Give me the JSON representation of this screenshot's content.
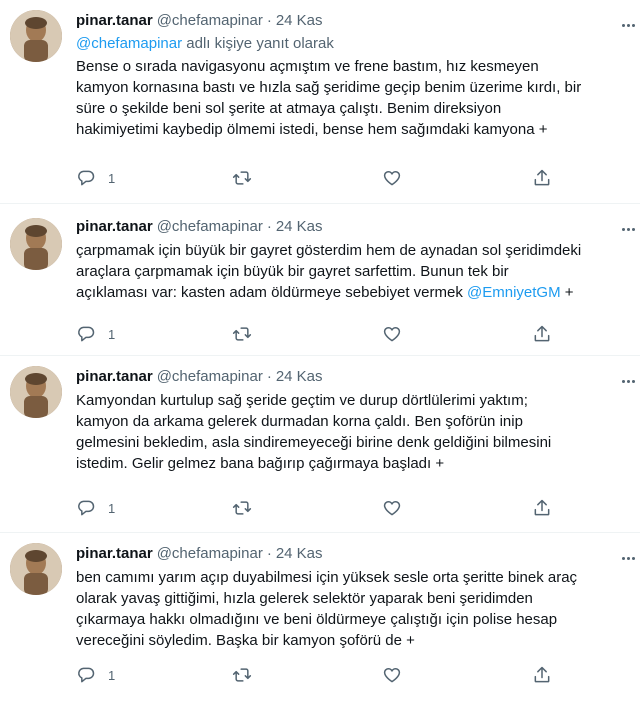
{
  "tweets": [
    {
      "name": "pinar.tanar",
      "handle": "@chefamapinar",
      "sep": "·",
      "date": "24 Kas",
      "reply_mention": "@chefamapinar",
      "reply_suffix": " adlı kişiye yanıt olarak",
      "lines": [
        "Bense o sırada navigasyonu açmıştım ve frene bastım, hız kesmeyen",
        "kamyon kornasına bastı ve hızla sağ şeridime geçip benim üzerime kırdı, bir",
        "süre o şekilde beni sol şerite at atmaya çalıştı. Benim direksiyon",
        "hakimiyetimi kaybedip ölmemi istedi, bense hem sağımdaki kamyona +"
      ],
      "reply_count": "1"
    },
    {
      "name": "pinar.tanar",
      "handle": "@chefamapinar",
      "sep": "·",
      "date": "24 Kas",
      "lines": [
        "çarpmamak için büyük bir gayret gösterdim hem de aynadan sol şeridimdeki",
        "araçlara çarpmamak için büyük bir gayret sarfettim. Bunun tek bir"
      ],
      "last_line_prefix": "açıklaması var: kasten adam öldürmeye sebebiyet vermek ",
      "last_line_mention": "@EmniyetGM",
      "last_line_suffix": " +",
      "reply_count": "1"
    },
    {
      "name": "pinar.tanar",
      "handle": "@chefamapinar",
      "sep": "·",
      "date": "24 Kas",
      "lines": [
        "Kamyondan kurtulup sağ şeride geçtim ve durup dörtlülerimi yaktım;",
        "kamyon da arkama gelerek durmadan korna çaldı. Ben şoförün inip",
        "gelmesini bekledim, asla sindiremeyeceği birine denk geldiğini bilmesini",
        "istedim. Gelir gelmez bana bağırıp çağırmaya başladı +"
      ],
      "reply_count": "1"
    },
    {
      "name": "pinar.tanar",
      "handle": "@chefamapinar",
      "sep": "·",
      "date": "24 Kas",
      "lines": [
        "ben camımı yarım açıp duyabilmesi için yüksek sesle orta şeritte binek araç",
        "olarak yavaş gittiğimi, hızla gelerek selektör yaparak beni şeridimden",
        "çıkarmaya hakkı olmadığını ve beni öldürmeye çalıştığı için polise hesap",
        "vereceğini söyledim. Başka bir kamyon şoförü de +"
      ],
      "reply_count": "1"
    }
  ],
  "icons": {
    "reply": "reply-icon",
    "retweet": "retweet-icon",
    "like": "heart-icon",
    "share": "share-icon",
    "more": "more-icon"
  },
  "colors": {
    "text": "#0f1419",
    "secondary": "#536471",
    "link": "#1d9bf0",
    "divider": "#eff3f4"
  }
}
